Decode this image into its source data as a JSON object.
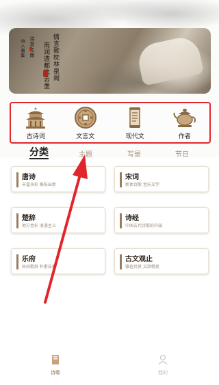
{
  "banner": {
    "columns": [
      "情言歌枕林泉阁",
      "雨润造都笔云墨",
      "诗意江南",
      "诗人雅集"
    ]
  },
  "categories": [
    {
      "label": "古诗词",
      "icon": "pavilion-icon"
    },
    {
      "label": "文言文",
      "icon": "ancient-coin-icon"
    },
    {
      "label": "现代文",
      "icon": "scroll-icon"
    },
    {
      "label": "作者",
      "icon": "teapot-icon"
    }
  ],
  "tabs": [
    {
      "label": "分类",
      "active": true
    },
    {
      "label": "主题",
      "active": false
    },
    {
      "label": "写景",
      "active": false
    },
    {
      "label": "节日",
      "active": false
    }
  ],
  "cards": [
    {
      "title": "唐诗",
      "subtitle": "丰富多彩 推陈出新"
    },
    {
      "title": "宋词",
      "subtitle": "新体诗歌 音乐文学"
    },
    {
      "title": "楚辞",
      "subtitle": "地方色彩 浪漫主义"
    },
    {
      "title": "诗经",
      "subtitle": "中国古代诗歌的开端"
    },
    {
      "title": "乐府",
      "subtitle": "民间歌辞 朴素自然"
    },
    {
      "title": "古文观止",
      "subtitle": "雅俗共赏 文辞精美"
    }
  ],
  "bottom_nav": [
    {
      "label": "诗歌",
      "icon": "book-icon",
      "active": true
    },
    {
      "label": "我的",
      "icon": "user-icon",
      "active": false
    }
  ],
  "colors": {
    "highlight_box": "#e0262b",
    "accent_brown": "#9b7d5c",
    "tab_inactive": "#a79278"
  }
}
